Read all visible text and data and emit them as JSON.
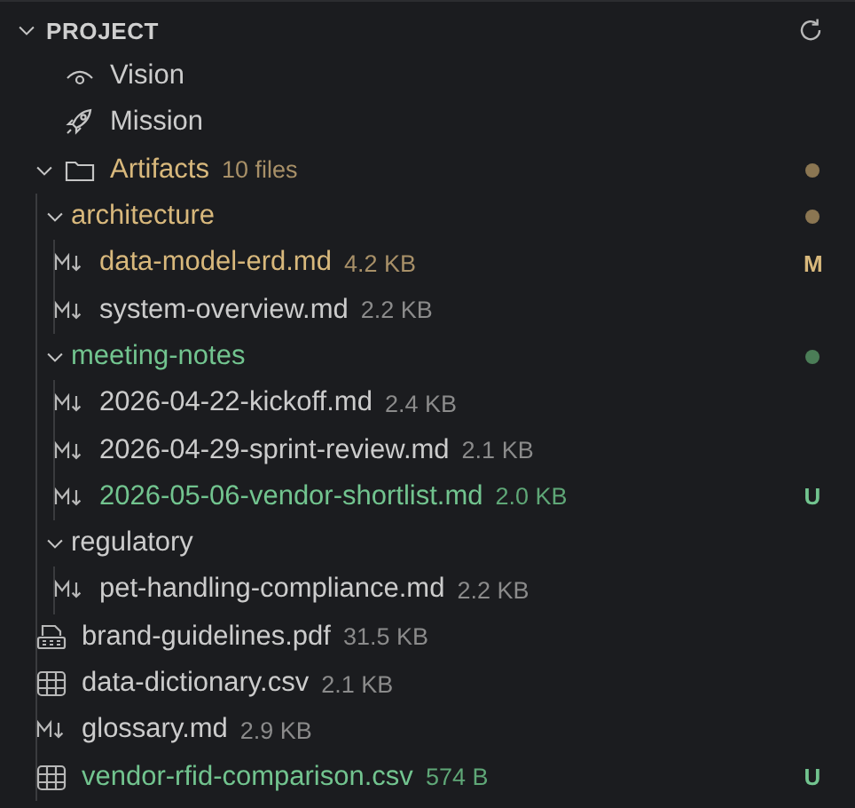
{
  "panel": {
    "title": "PROJECT",
    "expanded": true
  },
  "tree": [
    {
      "kind": "view",
      "name": "Vision"
    },
    {
      "kind": "goal",
      "name": "Mission"
    },
    {
      "kind": "folder",
      "name": "Artifacts",
      "meta": "10 files",
      "modified": true,
      "untracked": false,
      "expanded": true,
      "children": [
        {
          "kind": "folder",
          "name": "architecture",
          "modified": true,
          "untracked": false,
          "expanded": true,
          "children": [
            {
              "kind": "md",
              "name": "data-model-erd.md",
              "meta": "4.2 KB",
              "modified": true,
              "untracked": false,
              "badge": "M"
            },
            {
              "kind": "md",
              "name": "system-overview.md",
              "meta": "2.2 KB",
              "modified": false,
              "untracked": false
            }
          ]
        },
        {
          "kind": "folder",
          "name": "meeting-notes",
          "modified": false,
          "untracked": true,
          "expanded": true,
          "children": [
            {
              "kind": "md",
              "name": "2026-04-22-kickoff.md",
              "meta": "2.4 KB",
              "modified": false,
              "untracked": false
            },
            {
              "kind": "md",
              "name": "2026-04-29-sprint-review.md",
              "meta": "2.1 KB",
              "modified": false,
              "untracked": false
            },
            {
              "kind": "md",
              "name": "2026-05-06-vendor-shortlist.md",
              "meta": "2.0 KB",
              "modified": false,
              "untracked": true,
              "badge": "U"
            }
          ]
        },
        {
          "kind": "folder",
          "name": "regulatory",
          "modified": false,
          "untracked": false,
          "expanded": true,
          "children": [
            {
              "kind": "md",
              "name": "pet-handling-compliance.md",
              "meta": "2.2 KB",
              "modified": false,
              "untracked": false
            }
          ]
        },
        {
          "kind": "pdf",
          "name": "brand-guidelines.pdf",
          "meta": "31.5 KB",
          "modified": false,
          "untracked": false
        },
        {
          "kind": "csv",
          "name": "data-dictionary.csv",
          "meta": "2.1 KB",
          "modified": false,
          "untracked": false
        },
        {
          "kind": "md",
          "name": "glossary.md",
          "meta": "2.9 KB",
          "modified": false,
          "untracked": false
        },
        {
          "kind": "csv",
          "name": "vendor-rfid-comparison.csv",
          "meta": "574 B",
          "modified": false,
          "untracked": true,
          "badge": "U"
        }
      ]
    }
  ]
}
